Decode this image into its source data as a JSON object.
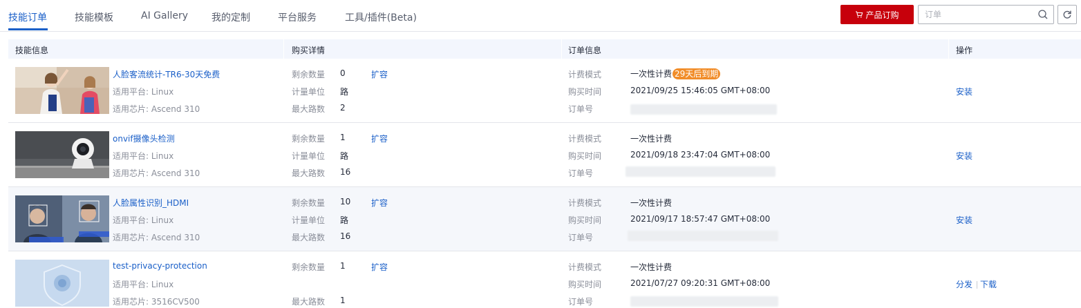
{
  "tabs": [
    {
      "label": "技能订单",
      "active": true
    },
    {
      "label": "技能模板"
    },
    {
      "label": "AI Gallery"
    },
    {
      "label": "我的定制"
    },
    {
      "label": "平台服务"
    },
    {
      "label": "工具/插件(Beta)"
    }
  ],
  "toolbar": {
    "buy_label": "产品订购",
    "search_placeholder": "订单",
    "search_value": ""
  },
  "table": {
    "headers": [
      "技能信息",
      "购买详情",
      "订单信息",
      "操作"
    ],
    "labels": {
      "platform": "适用平台: ",
      "chip": "适用芯片: ",
      "remaining": "剩余数量",
      "unit": "计量单位",
      "max_paths": "最大路数",
      "expand": "扩容",
      "billing_mode": "计费模式",
      "purchase_time": "购买时间",
      "order_no": "订单号"
    },
    "rows": [
      {
        "name": "人脸客流统计-TR6-30天免费",
        "thumb_icon": "people-photo",
        "platform": "适用平台: Linux",
        "chip": "适用芯片: Ascend 310",
        "remaining": "0",
        "unit": "路",
        "max_paths": "2",
        "billing_mode": "一次性计费",
        "badge": "29天后到期",
        "purchase_time": "2021/09/25 15:46:05 GMT+08:00",
        "actions": [
          "安装"
        ]
      },
      {
        "name": "onvif摄像头检测",
        "thumb_icon": "camera-photo",
        "platform": "适用平台: Linux",
        "chip": "适用芯片: Ascend 310",
        "remaining": "1",
        "unit": "路",
        "max_paths": "16",
        "billing_mode": "一次性计费",
        "badge": "",
        "purchase_time": "2021/09/18 23:47:04 GMT+08:00",
        "actions": [
          "安装"
        ]
      },
      {
        "name": "人脸属性识别_HDMI",
        "thumb_icon": "face-detect-photo",
        "platform": "适用平台: Linux",
        "chip": "适用芯片: Ascend 310",
        "remaining": "10",
        "unit": "路",
        "max_paths": "16",
        "billing_mode": "一次性计费",
        "badge": "",
        "purchase_time": "2021/09/17 18:57:47 GMT+08:00",
        "actions": [
          "安装"
        ]
      },
      {
        "name": "test-privacy-protection",
        "thumb_icon": "privacy-shield-photo",
        "platform": "适用平台: Linux",
        "chip": "适用芯片: 3516CV500",
        "remaining": "1",
        "unit": "",
        "max_paths": "1",
        "billing_mode": "一次性计费",
        "badge": "",
        "purchase_time": "2021/07/27 09:20:31 GMT+08:00",
        "actions": [
          "分发",
          "下载"
        ]
      }
    ]
  },
  "colors": {
    "accent": "#1a5fc8",
    "brand_red": "#c7000b",
    "badge_orange": "#f18d2a",
    "header_bg": "#f3f6fd"
  }
}
